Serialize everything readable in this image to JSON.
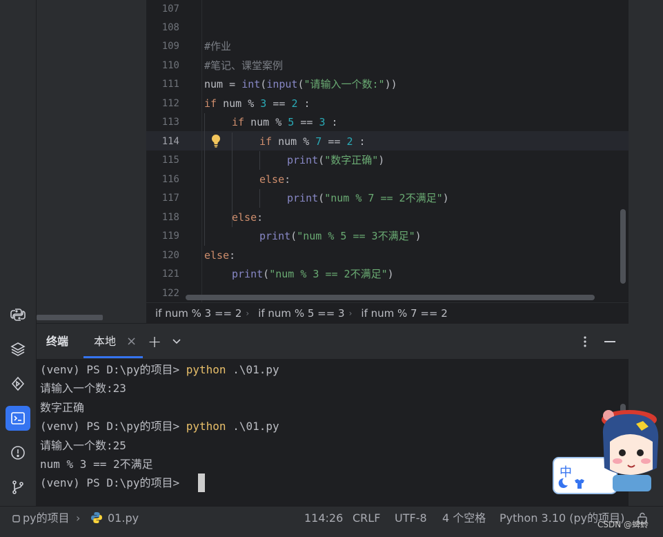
{
  "editor": {
    "line_numbers": [
      "107",
      "108",
      "109",
      "110",
      "111",
      "112",
      "113",
      "114",
      "115",
      "116",
      "117",
      "118",
      "119",
      "120",
      "121",
      "122"
    ],
    "current_line": "114",
    "lines": {
      "l109": "#作业",
      "l110": "#笔记、课堂案例",
      "l111_a": "num = ",
      "l111_fn1": "int",
      "l111_b": "(",
      "l111_fn2": "input",
      "l111_c": "(",
      "l111_str": "\"请输入一个数:\"",
      "l111_d": "))",
      "l112_kw": "if",
      "l112_a": " num % ",
      "l112_n1": "3",
      "l112_b": " == ",
      "l112_n2": "2",
      "l112_c": " :",
      "l113_kw": "if",
      "l113_a": " num % ",
      "l113_n1": "5",
      "l113_b": " == ",
      "l113_n2": "3",
      "l113_c": " :",
      "l114_kw": "if",
      "l114_a": " num % ",
      "l114_n1": "7",
      "l114_b": " == ",
      "l114_n2": "2",
      "l114_c": " :",
      "l115_fn": "print",
      "l115_a": "(",
      "l115_str": "\"数字正确\"",
      "l115_b": ")",
      "l116_kw": "else",
      "l116_a": ":",
      "l117_fn": "print",
      "l117_a": "(",
      "l117_str": "\"num % 7 == 2不满足\"",
      "l117_b": ")",
      "l118_kw": "else",
      "l118_a": ":",
      "l119_fn": "print",
      "l119_a": "(",
      "l119_str": "\"num % 5 == 3不满足\"",
      "l119_b": ")",
      "l120_kw": "else",
      "l120_a": ":",
      "l121_fn": "print",
      "l121_a": "(",
      "l121_str": "\"num % 3 == 2不满足\"",
      "l121_b": ")"
    },
    "intention_icon": "lightbulb-icon"
  },
  "breadcrumbs": [
    "if num % 3 == 2",
    "if num % 5 == 3",
    "if num % 7 == 2"
  ],
  "terminal": {
    "title": "终端",
    "tab_local": "本地",
    "close_glyph": "×",
    "add_glyph": "+",
    "lines": [
      {
        "prompt": "(venv) PS D:\\py的项目> ",
        "cmd": "python",
        "rest": " .\\01.py"
      },
      {
        "text": "请输入一个数:23"
      },
      {
        "text": "数字正确"
      },
      {
        "prompt": "(venv) PS D:\\py的项目> ",
        "cmd": "python",
        "rest": " .\\01.py"
      },
      {
        "text": "请输入一个数:25"
      },
      {
        "text": "num % 3 == 2不满足"
      },
      {
        "prompt": "(venv) PS D:\\py的项目> "
      }
    ]
  },
  "statusbar": {
    "project": "py的项目",
    "file": "01.py",
    "position": "114:26",
    "line_sep": "CRLF",
    "encoding": "UTF-8",
    "indent": "4 个空格",
    "interpreter": "Python 3.10 (py的项目)"
  },
  "watermark": "CSDN @蜱蛉",
  "ime_label": "中",
  "colors": {
    "accent": "#3574f0",
    "keyword": "#cf8e6d",
    "number": "#2aacb8",
    "string": "#6aab73",
    "builtin": "#8888c6",
    "comment": "#7a7e85",
    "command": "#e8bf6a"
  }
}
